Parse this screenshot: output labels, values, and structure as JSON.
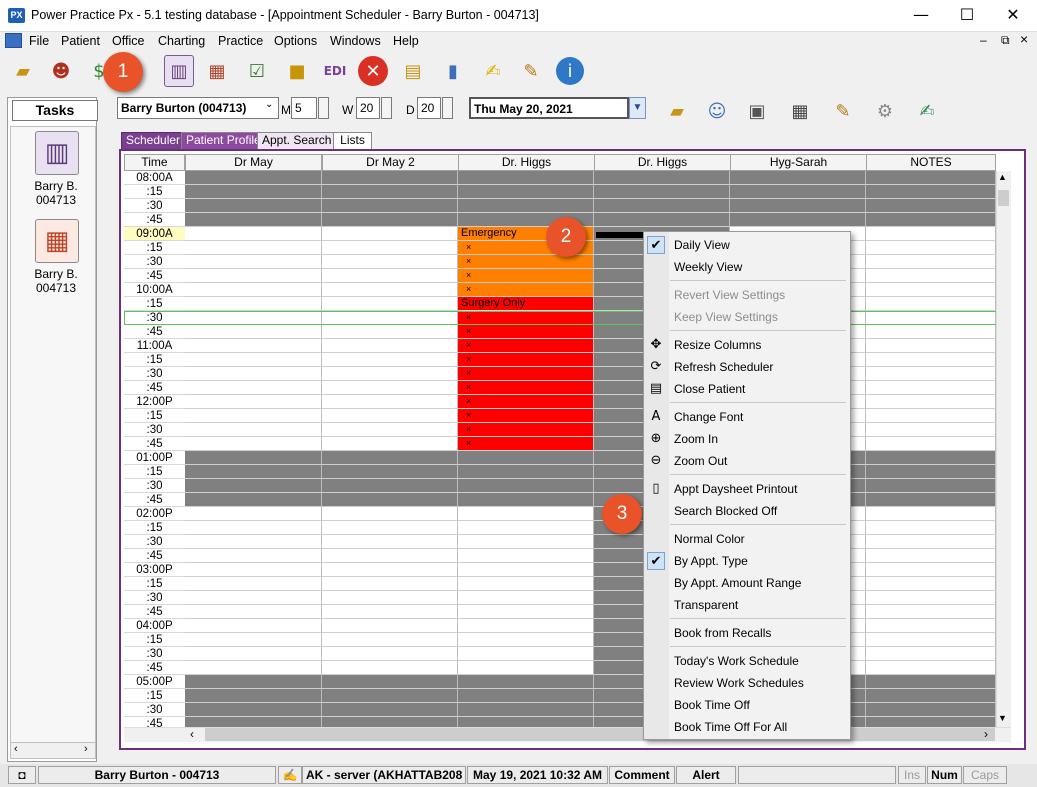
{
  "window": {
    "app_icon": "PX",
    "title": "Power Practice Px - 5.1 testing database - [Appointment Scheduler - Barry Burton - 004713]",
    "min_glyph": "—",
    "max_glyph": "☐",
    "close_glyph": "✕"
  },
  "menu": {
    "items": [
      "File",
      "Patient",
      "Office",
      "Charting",
      "Practice",
      "Options",
      "Windows",
      "Help"
    ],
    "mdi_controls": [
      "–",
      "⧉",
      "×"
    ]
  },
  "toolbar": {
    "icons": [
      "open-folder-icon",
      "patients-icon",
      "money-icon",
      "appointment-book-icon",
      "chart-icon",
      "checklist-icon",
      "gift-icon",
      "edi-icon",
      "cancel-icon",
      "documents-icon",
      "medication-icon",
      "notes-hand-icon",
      "notepad-icon",
      "info-icon"
    ]
  },
  "callouts": [
    "1",
    "2",
    "3"
  ],
  "tasks": {
    "title": "Tasks",
    "items": [
      {
        "name": "Barry B.",
        "id": "004713",
        "icon": "book-icon"
      },
      {
        "name": "Barry B.",
        "id": "004713",
        "icon": "chart-icon"
      }
    ]
  },
  "patient_bar": {
    "patient": "Barry Burton (004713)",
    "m_label": "M",
    "m_value": "5",
    "w_label": "W",
    "w_value": "20",
    "d_label": "D",
    "d_value": "20",
    "date": "Thu  May 20, 2021"
  },
  "tabs": [
    "Scheduler",
    "Patient Profile",
    "Appt. Search",
    "Lists"
  ],
  "columns": [
    "Time",
    "Dr May",
    "Dr May 2",
    "Dr. Higgs",
    "Dr. Higgs",
    "Hyg-Sarah",
    "NOTES"
  ],
  "times": [
    "08:00A",
    ":15",
    ":30",
    ":45",
    "09:00A",
    ":15",
    ":30",
    ":45",
    "10:00A",
    ":15",
    ":30",
    ":45",
    "11:00A",
    ":15",
    ":30",
    ":45",
    "12:00P",
    ":15",
    ":30",
    ":45",
    "01:00P",
    ":15",
    ":30",
    ":45",
    "02:00P",
    ":15",
    ":30",
    ":45",
    "03:00P",
    ":15",
    ":30",
    ":45",
    "04:00P",
    ":15",
    ":30",
    ":45",
    "05:00P",
    ":15",
    ":30",
    ":45"
  ],
  "blocks": {
    "emergency": "Emergency",
    "surgery": "Surgery Only",
    "marker": "×"
  },
  "context_menu": {
    "items": [
      {
        "label": "Daily View",
        "checked": true
      },
      {
        "label": "Weekly View"
      },
      {
        "sep": true
      },
      {
        "label": "Revert View Settings",
        "disabled": true
      },
      {
        "label": "Keep View Settings",
        "disabled": true
      },
      {
        "sep": true
      },
      {
        "label": "Resize Columns",
        "icon": "resize-icon",
        "glyph": "✥"
      },
      {
        "label": "Refresh Scheduler",
        "icon": "refresh-icon",
        "glyph": "⟳"
      },
      {
        "label": "Close Patient",
        "icon": "close-patient-icon",
        "glyph": "▤"
      },
      {
        "sep": true
      },
      {
        "label": "Change Font",
        "icon": "font-icon",
        "glyph": "A"
      },
      {
        "label": "Zoom In",
        "icon": "zoom-in-icon",
        "glyph": "⊕"
      },
      {
        "label": "Zoom Out",
        "icon": "zoom-out-icon",
        "glyph": "⊖"
      },
      {
        "sep": true
      },
      {
        "label": "Appt Daysheet Printout",
        "icon": "document-icon",
        "glyph": "▯"
      },
      {
        "label": "Search Blocked Off"
      },
      {
        "sep": true
      },
      {
        "label": "Normal Color"
      },
      {
        "label": "By Appt. Type",
        "checked": true
      },
      {
        "label": "By Appt. Amount Range"
      },
      {
        "label": "Transparent"
      },
      {
        "sep": true
      },
      {
        "label": "Book from Recalls"
      },
      {
        "sep": true
      },
      {
        "label": "Today's Work Schedule"
      },
      {
        "label": "Review Work Schedules"
      },
      {
        "label": "Book Time Off"
      },
      {
        "label": "Book Time Off For All"
      }
    ]
  },
  "status": {
    "patient": "Barry Burton - 004713",
    "server": "AK - server (AKHATTAB208",
    "datetime": "May 19, 2021 10:32 AM",
    "comment": "Comment",
    "alert": "Alert",
    "ins": "Ins",
    "num": "Num",
    "caps": "Caps"
  },
  "colors": {
    "blocked": "#808080",
    "emergency": "#ff7f00",
    "surgery": "#ff0000",
    "current_time": "#fffcc0",
    "frame": "#6b2f7e",
    "callout": "#e8532a"
  }
}
